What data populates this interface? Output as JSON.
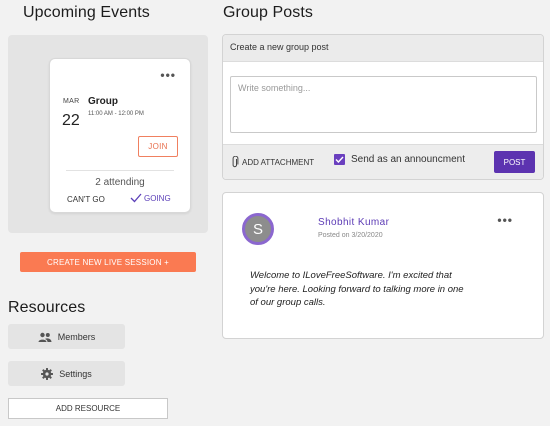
{
  "events": {
    "heading": "Upcoming Events",
    "card": {
      "month": "MAR",
      "day": "22",
      "title": "Group",
      "time": "11:00 AM - 12:00 PM",
      "join_label": "JOIN",
      "attending": "2 attending",
      "cant_go_label": "CAN'T GO",
      "going_label": "GOING"
    },
    "live_button": "CREATE NEW LIVE SESSION +"
  },
  "resources": {
    "heading": "Resources",
    "items": [
      {
        "label": "Members",
        "icon": "people-icon"
      },
      {
        "label": "Settings",
        "icon": "gear-icon"
      }
    ],
    "add_label": "ADD RESOURCE"
  },
  "group_posts": {
    "heading": "Group Posts",
    "composer": {
      "header": "Create a new group post",
      "placeholder": "Write something...",
      "attach_label": "ADD ATTACHMENT",
      "announce_label": "Send as an announcment",
      "announce_checked": true,
      "post_label": "POST"
    },
    "posts": [
      {
        "avatar_letter": "S",
        "author": "Shobhit Kumar",
        "posted": "Posted on 3/20/2020",
        "body": "Welcome to ILoveFreeSoftware. I'm excited that you're here. Looking forward to talking more in one of our group calls."
      }
    ]
  },
  "colors": {
    "accent_orange": "#fa7a52",
    "accent_purple": "#5c33b0"
  }
}
